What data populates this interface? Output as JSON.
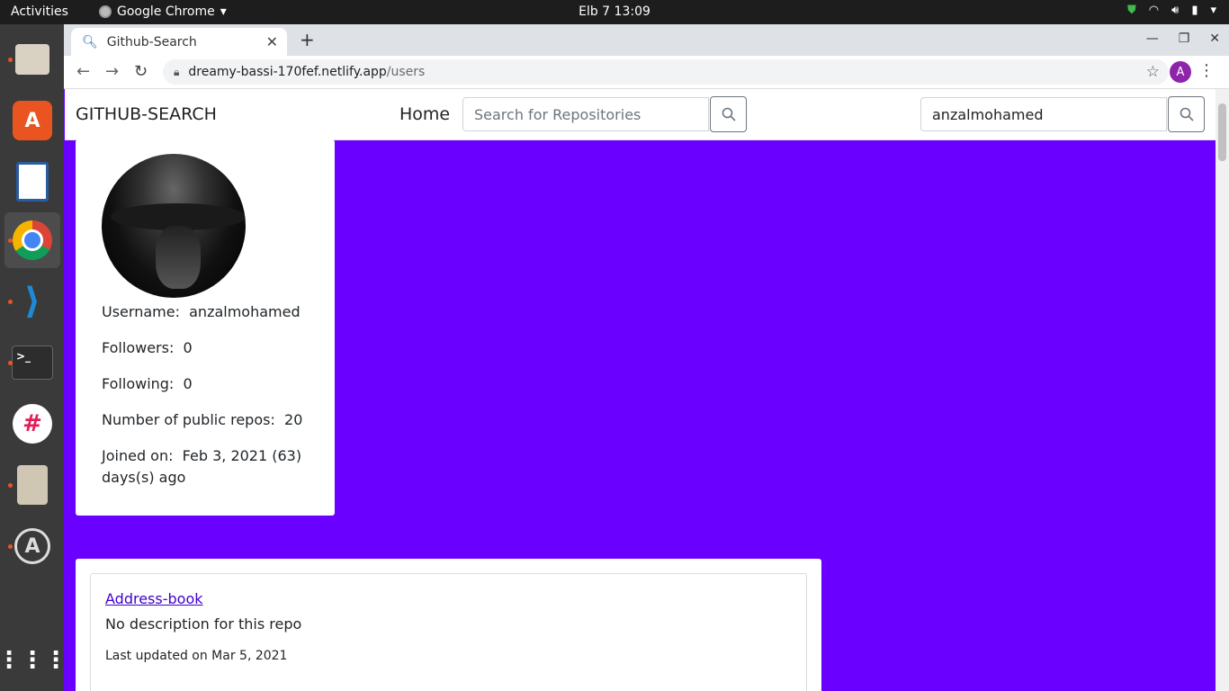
{
  "topbar": {
    "activities": "Activities",
    "app_menu": "Google Chrome",
    "clock": "Elb 7  13:09"
  },
  "dock": {
    "items": [
      "files-icon",
      "software-center-icon",
      "libreoffice-writer-icon",
      "chrome-icon",
      "vscode-icon",
      "terminal-icon",
      "slack-icon",
      "archive-icon",
      "app-store-icon",
      "show-apps-icon"
    ]
  },
  "browser": {
    "tab_title": "Github-Search",
    "url_host": "dreamy-bassi-170fef.netlify.app",
    "url_path": "/users",
    "profile_initial": "A"
  },
  "navbar": {
    "brand": "GITHUB-SEARCH",
    "home": "Home",
    "repo_search_placeholder": "Search for Repositories",
    "user_search_value": "anzalmohamed"
  },
  "profile": {
    "username_label": "Username:",
    "username": "anzalmohamed",
    "followers_label": "Followers:",
    "followers": "0",
    "following_label": "Following:",
    "following": "0",
    "repos_label": "Number of public repos:",
    "repos": "20",
    "joined_label": "Joined on:",
    "joined_value": "Feb 3, 2021 (63)",
    "joined_suffix": "days(s) ago"
  },
  "repos": [
    {
      "name": "Address-book",
      "description": "No description for this repo",
      "updated": "Last updated on Mar 5, 2021"
    }
  ],
  "colors": {
    "page_background": "#6a00ff",
    "link": "#3d00cc"
  }
}
